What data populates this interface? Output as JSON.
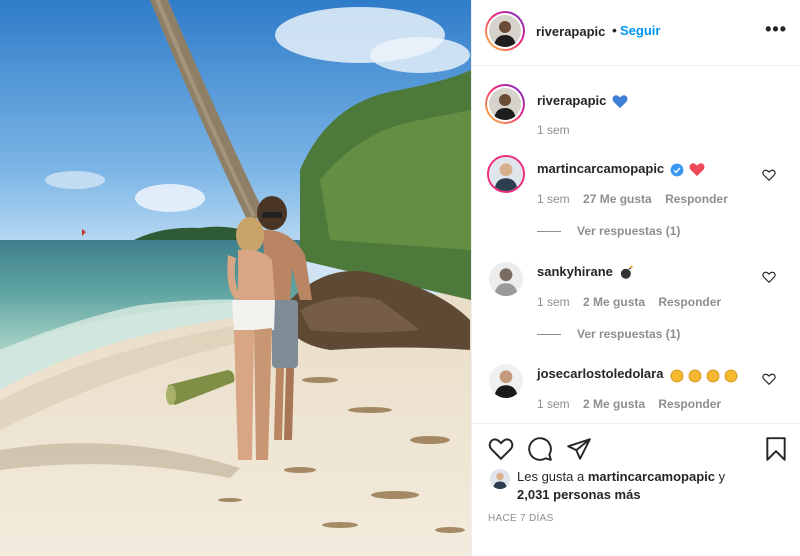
{
  "header": {
    "username": "riverapapic",
    "separator": "•",
    "follow_label": "Seguir",
    "more_label": "•••"
  },
  "caption": {
    "username": "riverapapic",
    "emoji": "blue-heart",
    "time": "1 sem"
  },
  "comments": [
    {
      "username": "martincarcamopapic",
      "verified": true,
      "emoji": "red-heart",
      "time": "1 sem",
      "likes": "27 Me gusta",
      "reply_label": "Responder",
      "view_replies": "Ver respuestas (1)"
    },
    {
      "username": "sankyhirane",
      "emoji": "bomb",
      "time": "1 sem",
      "likes": "2 Me gusta",
      "reply_label": "Responder",
      "view_replies": "Ver respuestas (1)"
    },
    {
      "username": "josecarlostoledolara",
      "emoji": "clapping-hands x4",
      "time": "1 sem",
      "likes": "2 Me gusta",
      "reply_label": "Responder"
    }
  ],
  "likes_summary": {
    "prefix": "Les gusta a",
    "user": "martincarcamopapic",
    "connector": "y",
    "others": "2,031 personas más"
  },
  "posted_ago": "HACE 7 DÍAS",
  "colors": {
    "accent": "#0095f6",
    "muted": "#8e8e8e",
    "text": "#262626",
    "verified": "#3897f0",
    "red_heart": "#ed4956",
    "blue_heart": "#3d7fd6"
  }
}
